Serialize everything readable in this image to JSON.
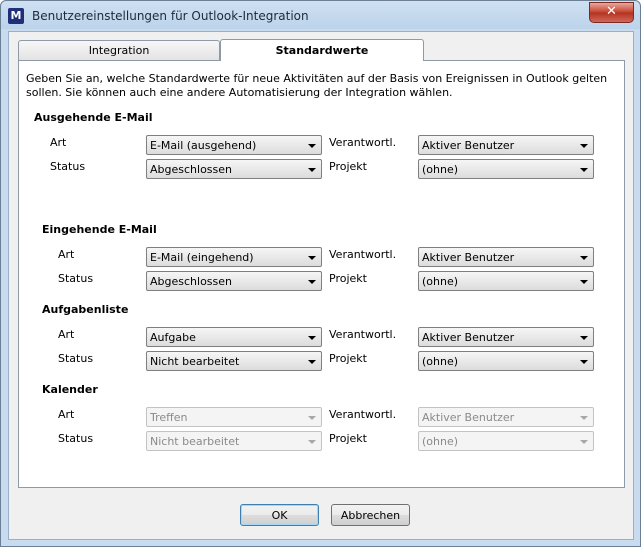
{
  "window": {
    "title": "Benutzereinstellungen für Outlook-Integration",
    "app_icon_letter": "M",
    "close_glyph": "✕"
  },
  "tabs": [
    {
      "label": "Integration"
    },
    {
      "label": "Standardwerte"
    }
  ],
  "description": "Geben Sie an, welche Standardwerte für neue Aktivitäten auf der Basis von Ereignissen in Outlook gelten sollen. Sie können auch eine andere Automatisierung der Integration wählen.",
  "labels": {
    "art": "Art",
    "status": "Status",
    "verantwortl": "Verantwortl.",
    "projekt": "Projekt"
  },
  "sections": [
    {
      "title": "Ausgehende E-Mail",
      "art": "E-Mail (ausgehend)",
      "status": "Abgeschlossen",
      "verantwortl": "Aktiver Benutzer",
      "projekt": "(ohne)",
      "enabled": true
    },
    {
      "title": "Eingehende E-Mail",
      "art": "E-Mail (eingehend)",
      "status": "Abgeschlossen",
      "verantwortl": "Aktiver Benutzer",
      "projekt": "(ohne)",
      "enabled": true
    },
    {
      "title": "Aufgabenliste",
      "art": "Aufgabe",
      "status": "Nicht bearbeitet",
      "verantwortl": "Aktiver Benutzer",
      "projekt": "(ohne)",
      "enabled": true
    },
    {
      "title": "Kalender",
      "art": "Treffen",
      "status": "Nicht bearbeitet",
      "verantwortl": "Aktiver Benutzer",
      "projekt": "(ohne)",
      "enabled": false
    }
  ],
  "buttons": {
    "ok": "OK",
    "cancel": "Abbrechen"
  }
}
